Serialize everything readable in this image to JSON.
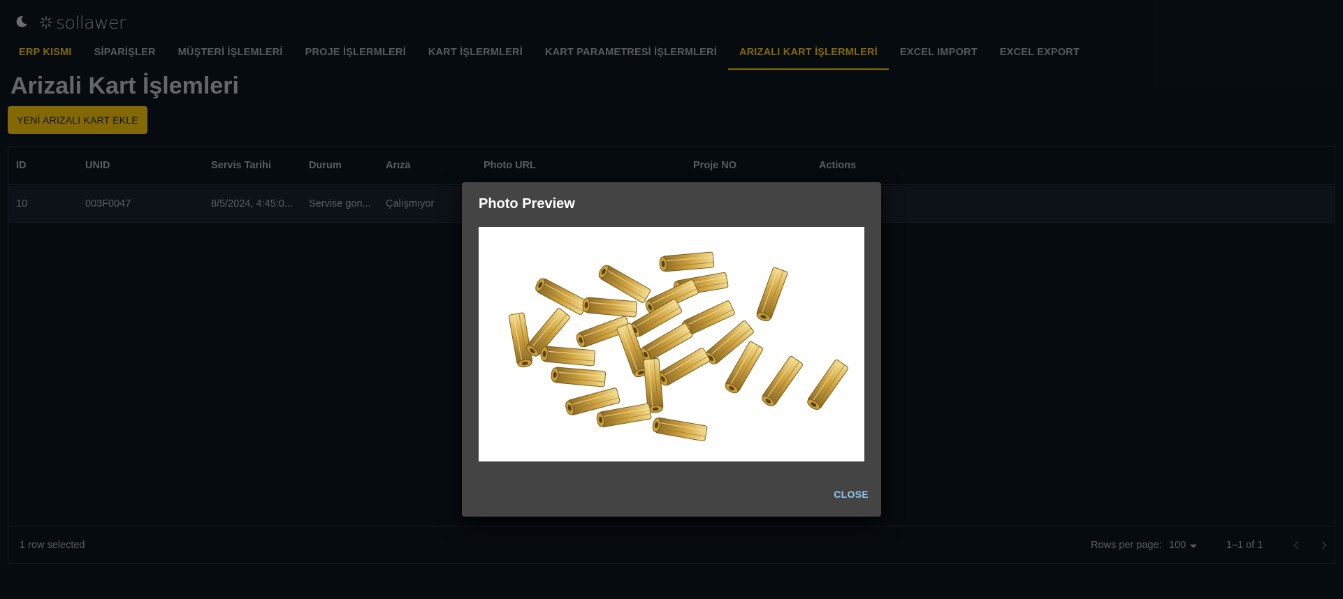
{
  "app": {
    "logo_text": "sollawer"
  },
  "nav": {
    "brand": "ERP KISMI",
    "tabs": [
      "SİPARİŞLER",
      "MÜŞTERİ İŞLEMLERİ",
      "PROJE İŞLERMLERİ",
      "KART İŞLERMLERİ",
      "KART PARAMETRESİ İŞLERMLERİ",
      "ARIZALI KART İŞLERMLERİ",
      "EXCEL IMPORT",
      "EXCEL EXPORT"
    ],
    "active_tab": "ARIZALI KART İŞLERMLERİ"
  },
  "page": {
    "title": "Arizali Kart İşlemleri",
    "add_button": "YENİ ARIZALI KART EKLE"
  },
  "table": {
    "columns": [
      "ID",
      "UNID",
      "Servis Tarihi",
      "Durum",
      "Arıza",
      "Photo URL",
      "Proje NO",
      "Actions"
    ],
    "rows": [
      {
        "id": "10",
        "unid": "003F0047",
        "servis_tarihi": "8/5/2024, 4:45:0...",
        "durum": "Servise gon...",
        "ariza": "Çalışmıyor"
      }
    ],
    "footer": {
      "selected": "1 row selected",
      "rows_per_page_label": "Rows per page:",
      "rows_per_page": "100",
      "range": "1–1 of 1"
    }
  },
  "dialog": {
    "title": "Photo Preview",
    "close_label": "CLOSE",
    "image_subject": "brass hex standoffs"
  },
  "colors": {
    "background": "#0a121a",
    "accent": "#c9a20a",
    "dialog_bg": "#444444",
    "close_link": "#90c6f0"
  }
}
